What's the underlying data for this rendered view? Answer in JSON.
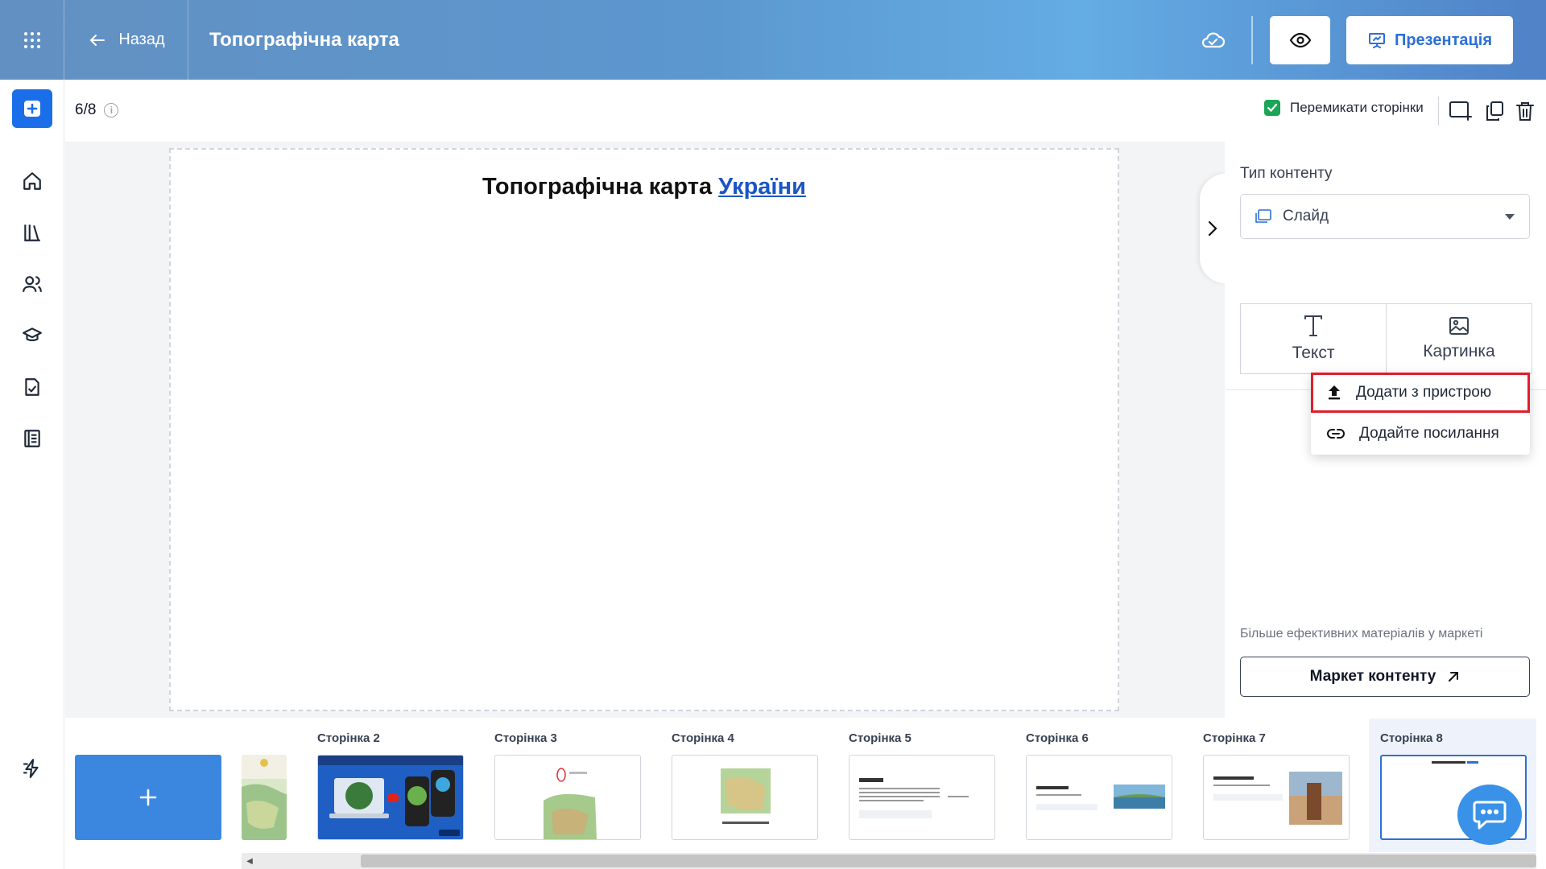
{
  "header": {
    "back_label": "Назад",
    "title": "Топографічна карта",
    "presentation_label": "Презентація",
    "icons": {
      "apps": "apps-grid-icon",
      "back": "arrow-left-icon",
      "cloud": "cloud-saved-icon",
      "preview": "eye-icon",
      "presentation": "presentation-icon"
    }
  },
  "sidebar": {
    "items": [
      {
        "name": "add",
        "icon": "plus-square-icon"
      },
      {
        "name": "home",
        "icon": "home-icon"
      },
      {
        "name": "library",
        "icon": "library-icon"
      },
      {
        "name": "users",
        "icon": "users-icon"
      },
      {
        "name": "courses",
        "icon": "graduation-cap-icon"
      },
      {
        "name": "tasks",
        "icon": "checklist-icon"
      },
      {
        "name": "journal",
        "icon": "journal-icon"
      },
      {
        "name": "updates",
        "icon": "lightning-icon"
      }
    ]
  },
  "toolbar": {
    "page_counter": "6/8",
    "switch_pages_label": "Перемикати сторінки",
    "switch_pages_checked": true
  },
  "slide": {
    "title_prefix": "Топографічна карта ",
    "title_link": "України"
  },
  "panel": {
    "content_type_label": "Тип контенту",
    "content_type_value": "Слайд",
    "tools": {
      "text_label": "Текст",
      "image_label": "Картинка"
    },
    "dropdown": {
      "upload_label": "Додати з пристрою",
      "link_label": "Додайте посилання"
    },
    "market_note": "Більше ефективних матеріалів у маркеті",
    "market_button_label": "Маркет контенту"
  },
  "filmstrip": {
    "pages": [
      {
        "label": ""
      },
      {
        "label": "Сторінка 2"
      },
      {
        "label": "Сторінка 3"
      },
      {
        "label": "Сторінка 4"
      },
      {
        "label": "Сторінка 5"
      },
      {
        "label": "Сторінка 6"
      },
      {
        "label": "Сторінка 7"
      },
      {
        "label": "Сторінка 8"
      }
    ],
    "active_page": 8
  },
  "colors": {
    "accent": "#2c6fd6",
    "add_button": "#1a6ee8",
    "highlight": "#e21d2b",
    "checkbox": "#1aa557"
  }
}
